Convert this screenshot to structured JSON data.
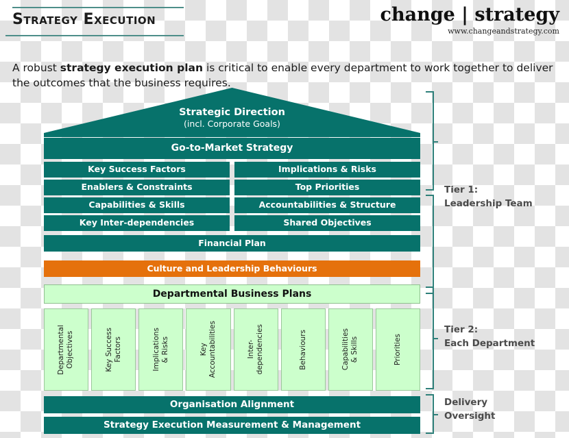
{
  "header": {
    "title": "Strategy Execution",
    "brand_name": "change | strategy",
    "brand_url": "www.changeandstrategy.com"
  },
  "intro": {
    "before": "A robust ",
    "bold": "strategy execution plan",
    "after": " is critical to enable every department to work together to deliver the outcomes that the business requires."
  },
  "colors": {
    "teal": "#07726B",
    "orange": "#E5710C",
    "light_green": "#CCFFCC",
    "bracket": "#2d7f79",
    "rule": "#4d8e89"
  },
  "diagram": {
    "roof": {
      "line1": "Strategic Direction",
      "line2": "(incl. Corporate Goals)"
    },
    "go_to_market": "Go-to-Market Strategy",
    "grid": [
      {
        "left": "Key Success Factors",
        "right": "Implications & Risks"
      },
      {
        "left": "Enablers & Constraints",
        "right": "Top Priorities"
      },
      {
        "left": "Capabilities & Skills",
        "right": "Accountabilities & Structure"
      },
      {
        "left": "Key Inter-dependencies",
        "right": "Shared Objectives"
      }
    ],
    "financial_plan": "Financial  Plan",
    "culture": "Culture and Leadership Behaviours",
    "departmental_business_plans": "Departmental Business Plans",
    "departments": [
      "Departmental\nObjectives",
      "Key Success\nFactors",
      "Implications\n& Risks",
      "Key\nAccountabilities",
      "Inter-\ndependencies",
      "Behaviours",
      "Capabilities\n& Skills",
      "Priorities"
    ],
    "organisation_alignment": "Organisation Alignment",
    "measurement": "Strategy Execution Measurement & Management"
  },
  "tiers": [
    {
      "line1": "Tier 1:",
      "line2": "Leadership Team"
    },
    {
      "line1": "Tier 2:",
      "line2": "Each Department"
    },
    {
      "line1": "Delivery",
      "line2": "Oversight"
    }
  ]
}
